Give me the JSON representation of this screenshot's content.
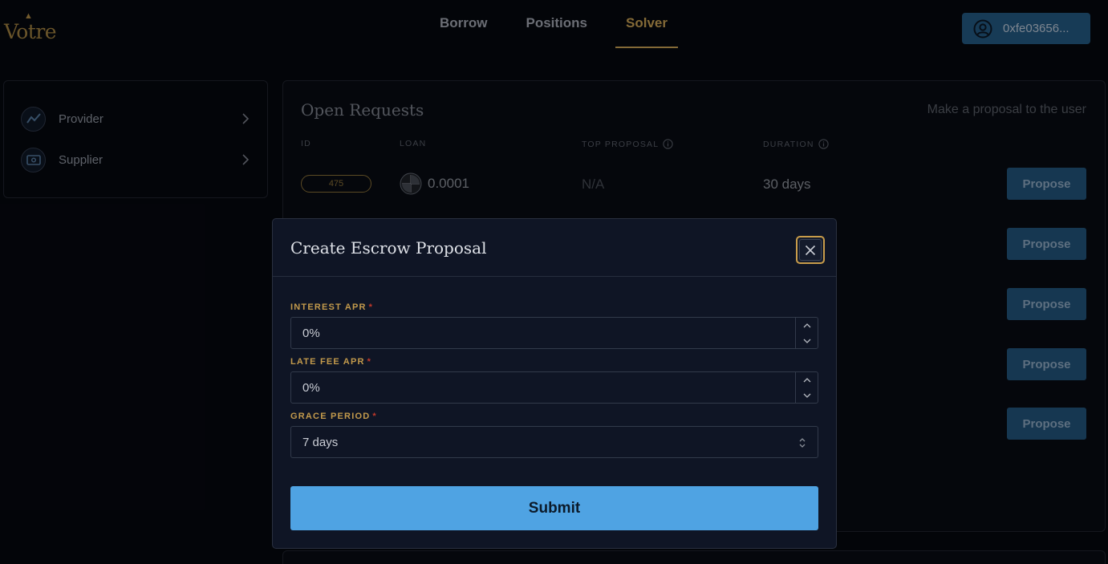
{
  "brand": {
    "name": "Votre",
    "accent": "#b08e4a"
  },
  "nav": {
    "items": [
      {
        "label": "Borrow",
        "active": false
      },
      {
        "label": "Positions",
        "active": false
      },
      {
        "label": "Solver",
        "active": true
      }
    ]
  },
  "wallet": {
    "address": "0xfe03656...",
    "icon": "user-circle-icon"
  },
  "sidebar": {
    "items": [
      {
        "label": "Provider",
        "icon": "trend-chart-icon"
      },
      {
        "label": "Supplier",
        "icon": "cash-icon"
      }
    ]
  },
  "panel": {
    "title": "Open Requests",
    "subtitle": "Make a proposal to the user",
    "columns": [
      "ID",
      "LOAN",
      "TOP PROPOSAL",
      "DURATION"
    ],
    "rows": [
      {
        "id": "475",
        "loan": "0.0001",
        "top_proposal": "N/A",
        "duration": "30 days",
        "action": "Propose"
      }
    ],
    "propose_label": "Propose"
  },
  "modal": {
    "title": "Create Escrow Proposal",
    "fields": {
      "interest_apr": {
        "label": "INTEREST APR",
        "value": "0%",
        "required": true
      },
      "late_fee_apr": {
        "label": "LATE FEE APR",
        "value": "0%",
        "required": true
      },
      "grace_period": {
        "label": "GRACE PERIOD",
        "value": "7 days",
        "required": true
      }
    },
    "required_mark": "*",
    "submit_label": "Submit"
  }
}
